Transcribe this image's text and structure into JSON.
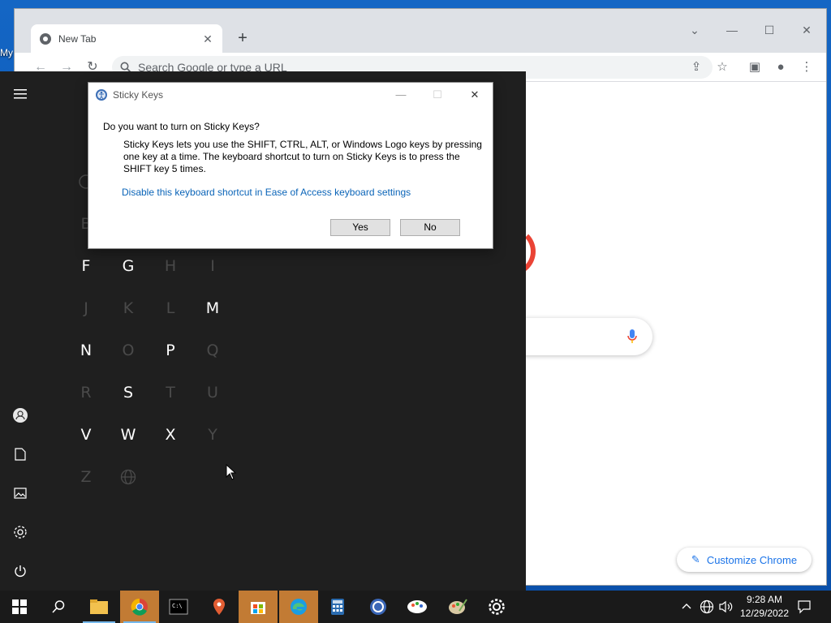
{
  "desktop": {
    "label": "My"
  },
  "chrome": {
    "tab_title": "New Tab",
    "omnibox_placeholder": "Search Google or type a URL",
    "customize_label": "Customize Chrome"
  },
  "start_menu": {
    "letters": [
      {
        "char": "F",
        "enabled": true
      },
      {
        "char": "G",
        "enabled": true
      },
      {
        "char": "H",
        "enabled": false
      },
      {
        "char": "I",
        "enabled": false
      },
      {
        "char": "J",
        "enabled": false
      },
      {
        "char": "K",
        "enabled": false
      },
      {
        "char": "L",
        "enabled": false
      },
      {
        "char": "M",
        "enabled": true
      },
      {
        "char": "N",
        "enabled": true
      },
      {
        "char": "O",
        "enabled": false
      },
      {
        "char": "P",
        "enabled": true
      },
      {
        "char": "Q",
        "enabled": false
      },
      {
        "char": "R",
        "enabled": false
      },
      {
        "char": "S",
        "enabled": true
      },
      {
        "char": "T",
        "enabled": false
      },
      {
        "char": "U",
        "enabled": false
      },
      {
        "char": "V",
        "enabled": true
      },
      {
        "char": "W",
        "enabled": true
      },
      {
        "char": "X",
        "enabled": true
      },
      {
        "char": "Y",
        "enabled": false
      },
      {
        "char": "Z",
        "enabled": false
      },
      {
        "char": "globe-icon",
        "enabled": false
      }
    ],
    "partial_letters": [
      "B"
    ]
  },
  "dialog": {
    "title": "Sticky Keys",
    "question": "Do you want to turn on Sticky Keys?",
    "body": "Sticky Keys lets you use the SHIFT, CTRL, ALT, or Windows Logo keys by pressing one key at a time. The keyboard shortcut to turn on Sticky Keys is to press the SHIFT key 5 times.",
    "link": "Disable this keyboard shortcut in Ease of Access keyboard settings",
    "yes_label": "Yes",
    "no_label": "No"
  },
  "taskbar": {
    "apps": [
      "file-explorer-icon",
      "chrome-icon",
      "terminal-icon",
      "maps-icon",
      "store-icon",
      "edge-icon",
      "calculator-icon",
      "vscode-like-icon",
      "paint-icon",
      "paint-palette-icon",
      "settings-icon"
    ],
    "time": "9:28 AM",
    "date": "12/29/2022"
  },
  "colors": {
    "accent_link": "#0a64b8",
    "chrome_blue": "#1a73e8",
    "start_bg": "#1f1f1f",
    "taskbar_highlight": "#c27b34"
  }
}
